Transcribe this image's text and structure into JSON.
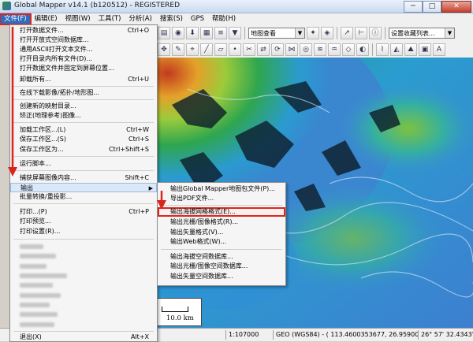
{
  "window": {
    "title": "Global Mapper v14.1 (b120512) - REGISTERED",
    "minimize": "─",
    "maximize": "□",
    "close": "✕"
  },
  "menubar": [
    {
      "label": "文件(F)",
      "active": true
    },
    {
      "label": "编辑(E)"
    },
    {
      "label": "视图(W)"
    },
    {
      "label": "工具(T)"
    },
    {
      "label": "分析(A)"
    },
    {
      "label": "搜索(S)"
    },
    {
      "label": "GPS"
    },
    {
      "label": "帮助(H)"
    }
  ],
  "toolbar": {
    "projection_combo": "地图查看",
    "digitizer_combo": "设置收藏列表..."
  },
  "file_menu": {
    "items": [
      {
        "label": "打开数据文件...",
        "shortcut": "Ctrl+O"
      },
      {
        "label": "打开开放式空间数据库..."
      },
      {
        "label": "通用ASCII打开文本文件..."
      },
      {
        "label": "打开目录内所有文件(D)..."
      },
      {
        "label": "打开数据文件并固定到屏幕位置..."
      },
      {
        "label": "卸载所有...",
        "shortcut": "Ctrl+U"
      },
      {
        "label": "在线下载影像/拓扑/地形图..."
      },
      {
        "label": "创建新的映射目录..."
      },
      {
        "label": "矫正(地理参考)图像..."
      },
      {
        "label": "加载工作区...(L)",
        "shortcut": "Ctrl+W"
      },
      {
        "label": "保存工作区...(S)",
        "shortcut": "Ctrl+S"
      },
      {
        "label": "保存工作区为...",
        "shortcut": "Ctrl+Shift+S"
      },
      {
        "label": "运行脚本..."
      },
      {
        "label": "捕获屏幕图像内容...",
        "shortcut": "Shift+C"
      },
      {
        "label": "输出"
      },
      {
        "label": "批量转换/重投影..."
      },
      {
        "label": "打印...(P)",
        "shortcut": "Ctrl+P"
      },
      {
        "label": "打印预览..."
      },
      {
        "label": "打印设置(R)..."
      },
      {
        "label": "退出(X)",
        "shortcut": "Alt+X"
      }
    ]
  },
  "export_submenu": {
    "items": [
      {
        "label": "输出Global Mapper地图包文件(P)..."
      },
      {
        "label": "导出PDF文件..."
      },
      {
        "label": "输出海拔网格格式(E)...",
        "highlighted": true
      },
      {
        "label": "输出光栅/图像格式(R)..."
      },
      {
        "label": "输出矢量格式(V)..."
      },
      {
        "label": "输出Web格式(W)..."
      },
      {
        "label": "输出海拔空间数据库..."
      },
      {
        "label": "输出光栅/图像空间数据库..."
      },
      {
        "label": "输出矢量空间数据库..."
      }
    ]
  },
  "map": {
    "scale_text": "10.0 km"
  },
  "statusbar": {
    "scale": "1:107000",
    "coords": "GEO (WGS84) - ( 113.4600353677, 26.9590095281 )",
    "dms": "26° 57' 32.4343\" N, 113°"
  },
  "colors": {
    "menu_highlight": "#2f6cc0",
    "annotation_red": "#d9261c"
  }
}
